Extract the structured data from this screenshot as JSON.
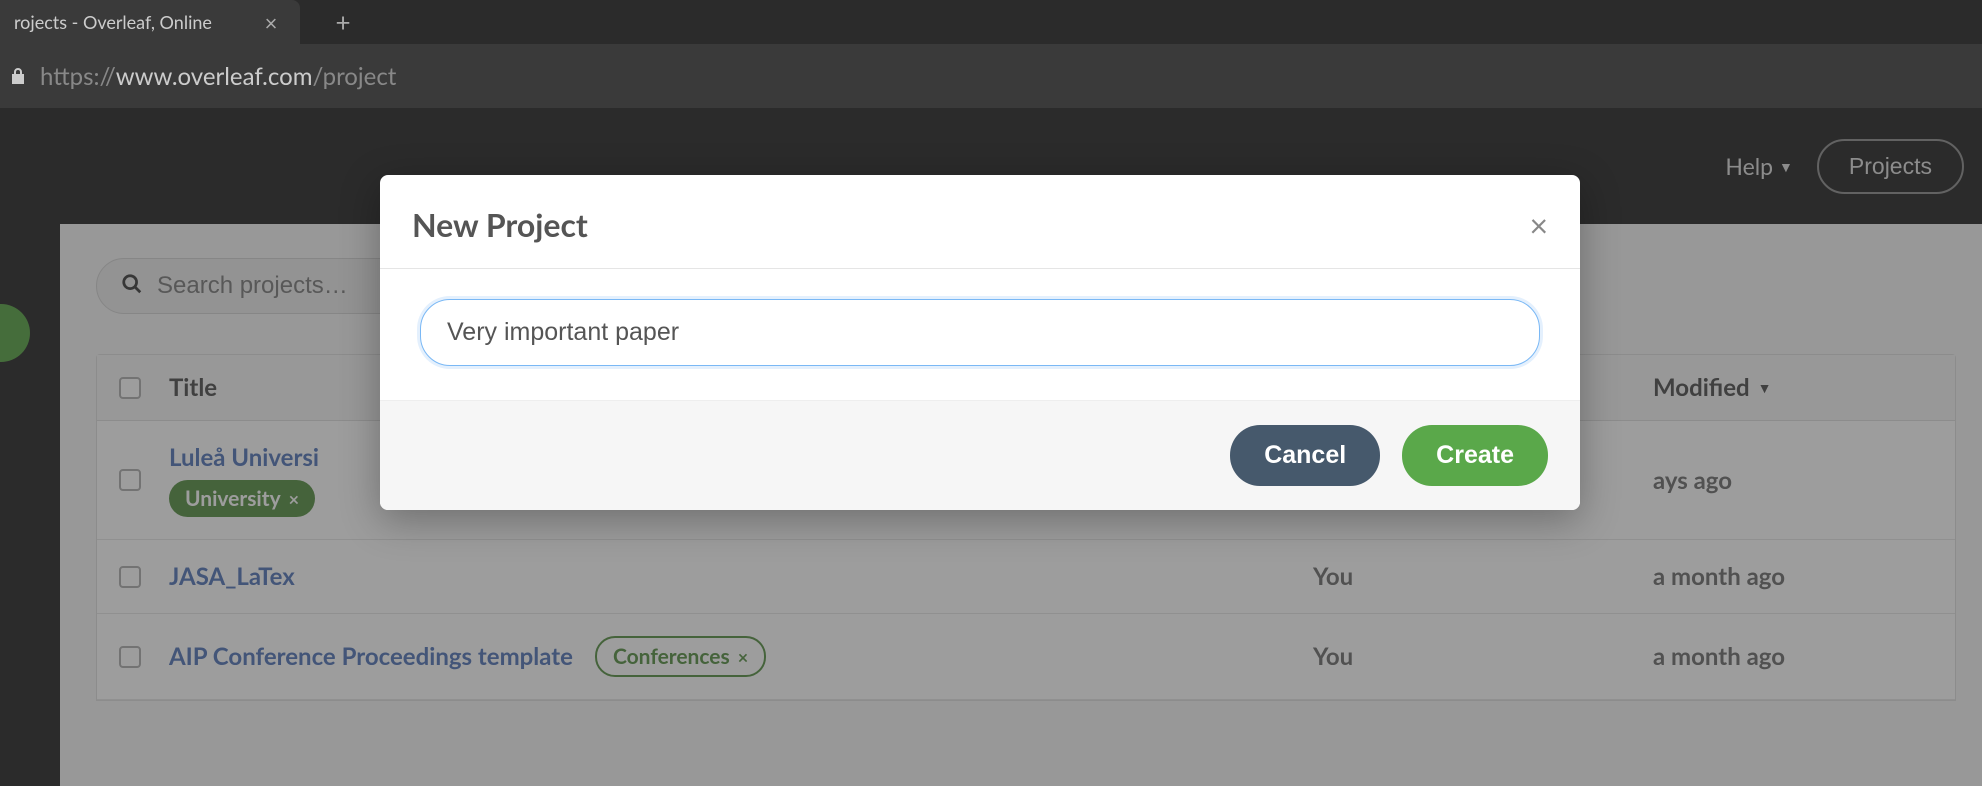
{
  "browser": {
    "tab_title": "rojects - Overleaf, Online",
    "url_protocol": "https://",
    "url_host": "www.overleaf.com",
    "url_path": "/project"
  },
  "header": {
    "help_label": "Help",
    "projects_label": "Projects"
  },
  "search": {
    "placeholder": "Search projects…"
  },
  "table": {
    "columns": {
      "title": "Title",
      "modified": "Modified"
    },
    "rows": [
      {
        "title": "Luleå Universi",
        "owner": "",
        "modified": "ays ago",
        "tag": "University",
        "tag_style": "solid"
      },
      {
        "title": "JASA_LaTex",
        "owner": "You",
        "modified": "a month ago"
      },
      {
        "title": "AIP Conference Proceedings template",
        "owner": "You",
        "modified": "a month ago",
        "tag": "Conferences",
        "tag_style": "outline"
      }
    ]
  },
  "modal": {
    "title": "New Project",
    "input_value": "Very important paper",
    "cancel_label": "Cancel",
    "create_label": "Create"
  }
}
